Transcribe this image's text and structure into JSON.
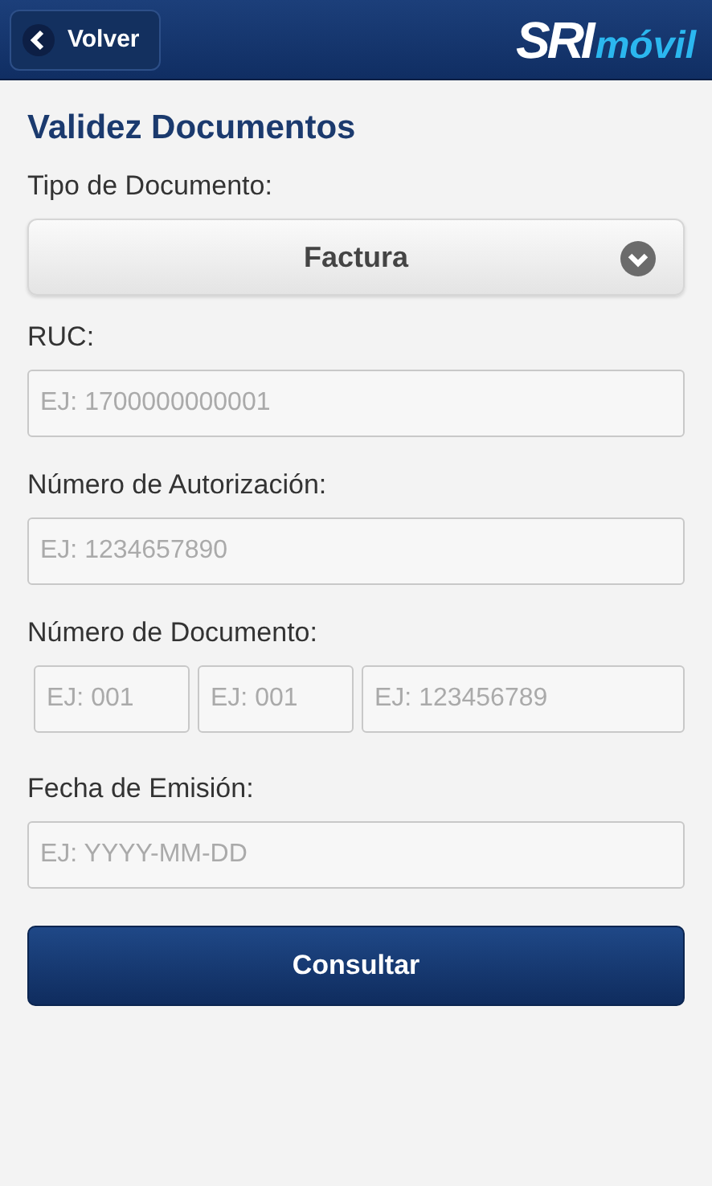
{
  "header": {
    "back_button": "Volver",
    "logo": {
      "part_1": "SRI",
      "part_2": "móvil"
    }
  },
  "title": "Validez Documentos",
  "document_type": {
    "label": "Tipo de Documento:",
    "value": "Factura"
  },
  "fields": [
    {
      "kind": "single",
      "label": "RUC:",
      "placeholders": [
        "EJ: 1700000000001"
      ]
    },
    {
      "kind": "single",
      "label": "Número de Autorización:",
      "placeholders": [
        "EJ: 1234657890"
      ]
    },
    {
      "kind": "multi",
      "label": "Número de Documento:",
      "placeholders": [
        "EJ: 001",
        "EJ: 001",
        "EJ: 123456789"
      ]
    },
    {
      "kind": "single",
      "label": "Fecha de Emisión:",
      "placeholders": [
        "EJ: YYYY-MM-DD"
      ]
    }
  ],
  "submit_button": "Consultar"
}
